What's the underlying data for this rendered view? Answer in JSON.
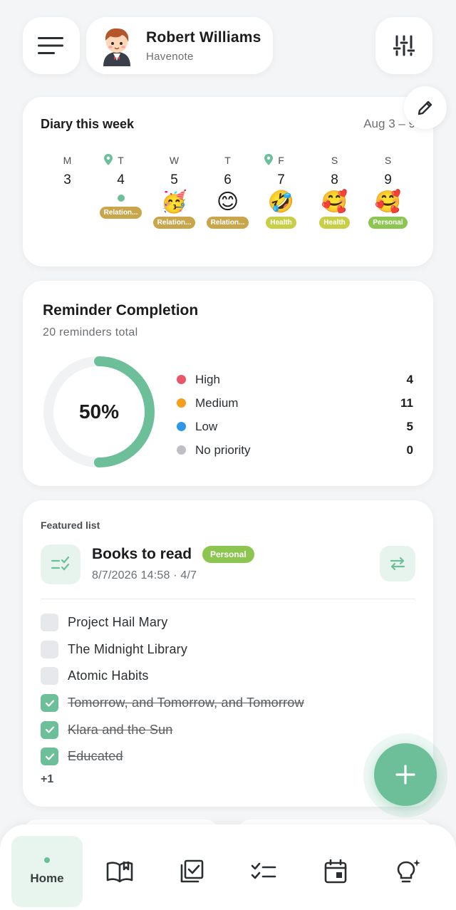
{
  "header": {
    "user_name": "Robert Williams",
    "app_name": "Havenote"
  },
  "diary": {
    "title": "Diary this week",
    "range": "Aug 3 – 9",
    "days": [
      {
        "letter": "M",
        "num": "3",
        "pin": false,
        "mood": "",
        "dot": false,
        "tag": "",
        "tag_type": ""
      },
      {
        "letter": "T",
        "num": "4",
        "pin": true,
        "mood": "",
        "dot": true,
        "tag": "Relation...",
        "tag_type": "rel"
      },
      {
        "letter": "W",
        "num": "5",
        "pin": false,
        "mood": "🥳",
        "dot": false,
        "tag": "Relation...",
        "tag_type": "rel"
      },
      {
        "letter": "T",
        "num": "6",
        "pin": false,
        "mood": "😊",
        "dot": false,
        "tag": "Relation...",
        "tag_type": "rel"
      },
      {
        "letter": "F",
        "num": "7",
        "pin": true,
        "mood": "🤣",
        "dot": false,
        "tag": "Health",
        "tag_type": "health"
      },
      {
        "letter": "S",
        "num": "8",
        "pin": false,
        "mood": "🥰",
        "dot": false,
        "tag": "Health",
        "tag_type": "health"
      },
      {
        "letter": "S",
        "num": "9",
        "pin": false,
        "mood": "🥰",
        "dot": false,
        "tag": "Personal",
        "tag_type": "personal"
      }
    ]
  },
  "reminders": {
    "title": "Reminder Completion",
    "subtitle": "20 reminders total",
    "completion_label": "50%",
    "completion_fraction": 0.5,
    "priorities": [
      {
        "label": "High",
        "count": "4",
        "color": "#e8566a"
      },
      {
        "label": "Medium",
        "count": "11",
        "color": "#f59e1c"
      },
      {
        "label": "Low",
        "count": "5",
        "color": "#2e97e8"
      },
      {
        "label": "No priority",
        "count": "0",
        "color": "#bdbfc3"
      }
    ]
  },
  "featured": {
    "caption": "Featured list",
    "title": "Books to read",
    "badge": "Personal",
    "meta": "8/7/2026 14:58 · 4/7",
    "items": [
      {
        "label": "Project Hail Mary",
        "done": false
      },
      {
        "label": "The Midnight Library",
        "done": false
      },
      {
        "label": "Atomic Habits",
        "done": false
      },
      {
        "label": "Tomorrow, and Tomorrow, and Tomorrow",
        "done": true
      },
      {
        "label": "Klara and the Sun",
        "done": true
      },
      {
        "label": "Educated",
        "done": true
      }
    ],
    "more": "+1"
  },
  "nav": {
    "home_label": "Home"
  },
  "colors": {
    "accent": "#6dbf9a",
    "accent_light": "#e7f4ee"
  }
}
